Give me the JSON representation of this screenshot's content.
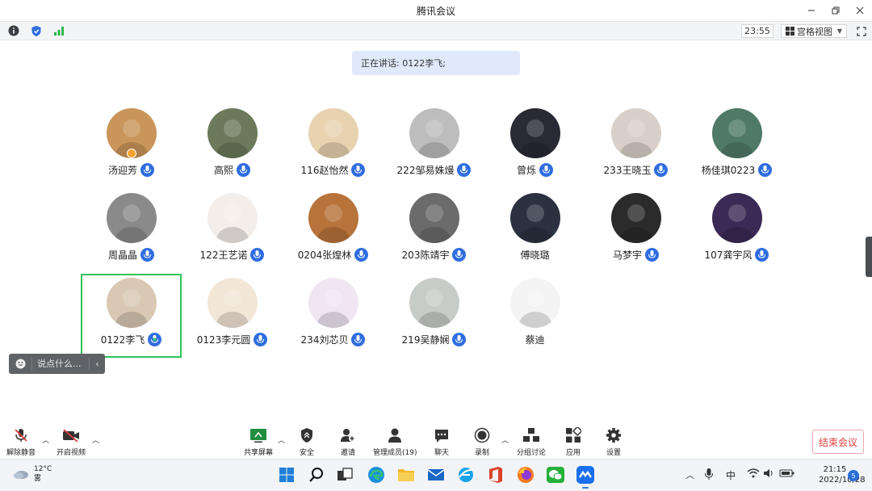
{
  "window": {
    "title": "腾讯会议"
  },
  "infobar": {
    "timer": "23:55",
    "view_label": "宫格视图"
  },
  "speaking": {
    "text": "正在讲话: 0122李飞;"
  },
  "participants": [
    {
      "name": "汤迎芳",
      "host": true,
      "mic": true,
      "bg": "#c9955a"
    },
    {
      "name": "高熙",
      "mic": true,
      "bg": "#6a7a5a"
    },
    {
      "name": "116赵怡然",
      "mic": true,
      "bg": "#e8d2b0"
    },
    {
      "name": "222邹易姝熳",
      "mic": true,
      "bg": "#bdbdbd"
    },
    {
      "name": "曾烁",
      "mic": true,
      "bg": "#2a2a35"
    },
    {
      "name": "233王晓玉",
      "mic": true,
      "bg": "#d8d0c8"
    },
    {
      "name": "杨佳琪0223",
      "mic": true,
      "bg": "#4f7a68"
    },
    {
      "name": "周晶晶",
      "mic": true,
      "bg": "#8a8a8a"
    },
    {
      "name": "122王艺诺",
      "mic": true,
      "bg": "#f4eeea"
    },
    {
      "name": "0204张煌林",
      "mic": true,
      "bg": "#b8733a"
    },
    {
      "name": "203陈靖宇",
      "mic": true,
      "bg": "#6b6b6b"
    },
    {
      "name": "傅晓璐",
      "mic": false,
      "bg": "#2c3140"
    },
    {
      "name": "马梦宇",
      "mic": true,
      "bg": "#2b2b2b"
    },
    {
      "name": "107龚宇风",
      "mic": true,
      "bg": "#3a2a55"
    },
    {
      "name": "0122李飞",
      "mic": true,
      "speaking": true,
      "bg": "#d9c8b3"
    },
    {
      "name": "0123李元圆",
      "mic": true,
      "bg": "#f2e6d6"
    },
    {
      "name": "234刘芯贝",
      "mic": true,
      "bg": "#efe6f2"
    },
    {
      "name": "219吴静娴",
      "mic": true,
      "bg": "#c8ccc8"
    },
    {
      "name": "蔡迪",
      "mic": false,
      "bg": "#f4f4f4"
    }
  ],
  "chat": {
    "placeholder": "说点什么..."
  },
  "toolbar": {
    "unmute": "解除静音",
    "video": "开启视频",
    "share": "共享屏幕",
    "security": "安全",
    "invite": "邀请",
    "members": "管理成员(19)",
    "chat": "聊天",
    "record": "录制",
    "breakout": "分组讨论",
    "apps": "应用",
    "settings": "设置",
    "end": "结束会议"
  },
  "taskbar": {
    "temperature": "12°C",
    "weather": "雾",
    "ime": "中",
    "time": "21:15",
    "date": "2022/10/28",
    "notifications": "5"
  }
}
